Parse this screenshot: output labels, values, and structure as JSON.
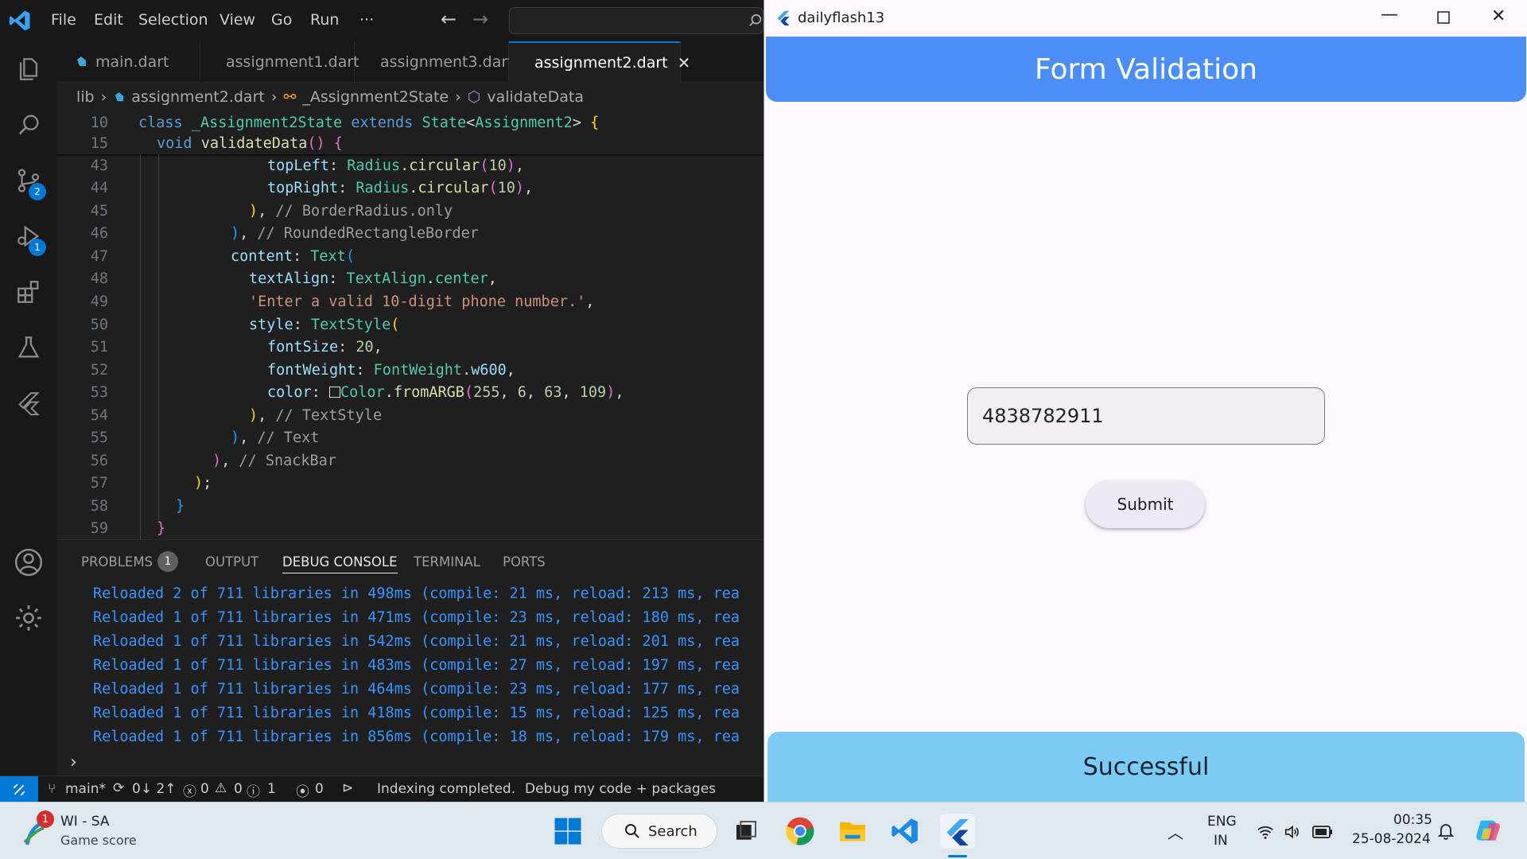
{
  "vscode": {
    "menu": [
      "File",
      "Edit",
      "Selection",
      "View",
      "Go",
      "Run",
      "···"
    ],
    "tabs": [
      {
        "label": "main.dart"
      },
      {
        "label": "assignment1.dart"
      },
      {
        "label": "assignment3.dart"
      },
      {
        "label": "assignment2.dart",
        "active": true
      }
    ],
    "breadcrumb": {
      "folder": "lib",
      "file": "assignment2.dart",
      "class": "_Assignment2State",
      "method": "validateData"
    },
    "activity_badges": {
      "source_control": "2",
      "run_debug": "1"
    },
    "line_numbers": [
      "10",
      "15",
      "43",
      "44",
      "45",
      "46",
      "47",
      "48",
      "49",
      "50",
      "51",
      "52",
      "53",
      "54",
      "55",
      "56",
      "57",
      "58",
      "59"
    ],
    "panel": {
      "tabs": [
        "PROBLEMS",
        "OUTPUT",
        "DEBUG CONSOLE",
        "TERMINAL",
        "PORTS"
      ],
      "problems_count": "1",
      "active_tab": "DEBUG CONSOLE"
    },
    "console_lines": [
      "Reloaded 2 of 711 libraries in 498ms (compile: 21 ms, reload: 213 ms, rea",
      "Reloaded 1 of 711 libraries in 471ms (compile: 23 ms, reload: 180 ms, rea",
      "Reloaded 1 of 711 libraries in 542ms (compile: 21 ms, reload: 201 ms, rea",
      "Reloaded 1 of 711 libraries in 483ms (compile: 27 ms, reload: 197 ms, rea",
      "Reloaded 1 of 711 libraries in 464ms (compile: 23 ms, reload: 177 ms, rea",
      "Reloaded 1 of 711 libraries in 418ms (compile: 15 ms, reload: 125 ms, rea",
      "Reloaded 1 of 711 libraries in 856ms (compile: 18 ms, reload: 179 ms, rea"
    ],
    "status": {
      "branch": "main*",
      "sync": "0↓ 2↑",
      "errors": "0",
      "warnings": "0",
      "info": "1",
      "ports": "0",
      "indexing": "Indexing completed.",
      "debug": "Debug my code + packages"
    }
  },
  "flutter": {
    "window_title": "dailyflash13",
    "appbar_title": "Form Validation",
    "phone_value": "4838782911",
    "submit_label": "Submit",
    "snackbar_text": "Successful"
  },
  "taskbar": {
    "news_title": "WI - SA",
    "news_sub": "Game score",
    "news_badge": "1",
    "search_label": "Search",
    "lang": "ENG",
    "region": "IN",
    "time": "00:35",
    "date": "25-08-2024"
  },
  "colors": {
    "vscode_accent": "#0078d4",
    "appbar": "#4b8ef7",
    "snackbar": "#7ccbf4"
  }
}
